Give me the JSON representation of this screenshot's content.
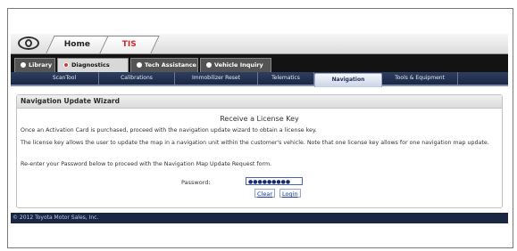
{
  "topbar": {
    "logo_icon": "toyota-logo-icon",
    "tabs": [
      "Home",
      "TIS"
    ],
    "accent_color": "#cc2b2b"
  },
  "secondary_tabs": {
    "items": [
      "Library",
      "Diagnostics",
      "Tech Assistance",
      "Vehicle Inquiry"
    ],
    "active": "Diagnostics"
  },
  "nav": {
    "items": [
      "ScanTool",
      "Calibrations",
      "Immobilizer Reset",
      "Telematics",
      "Navigation",
      "Tools & Equipment"
    ],
    "active": "Navigation"
  },
  "panel": {
    "header": "Navigation Update Wizard",
    "title": "Receive a License Key",
    "paragraphs": [
      "Once an Activation Card is purchased, proceed with the navigation update wizard to obtain a license key.",
      "The license key allows the user to update the map in a navigation unit within the customer's vehicle. Note that one license key allows for one navigation map update.",
      "Re-enter your Password below to proceed with the Navigation Map Update Request form."
    ],
    "password_label": "Password:",
    "password_value": "●●●●●●●●●",
    "clear_label": "Clear",
    "login_label": "Login"
  },
  "footer": {
    "copyright": "© 2012 Toyota Motor Sales, Inc."
  }
}
